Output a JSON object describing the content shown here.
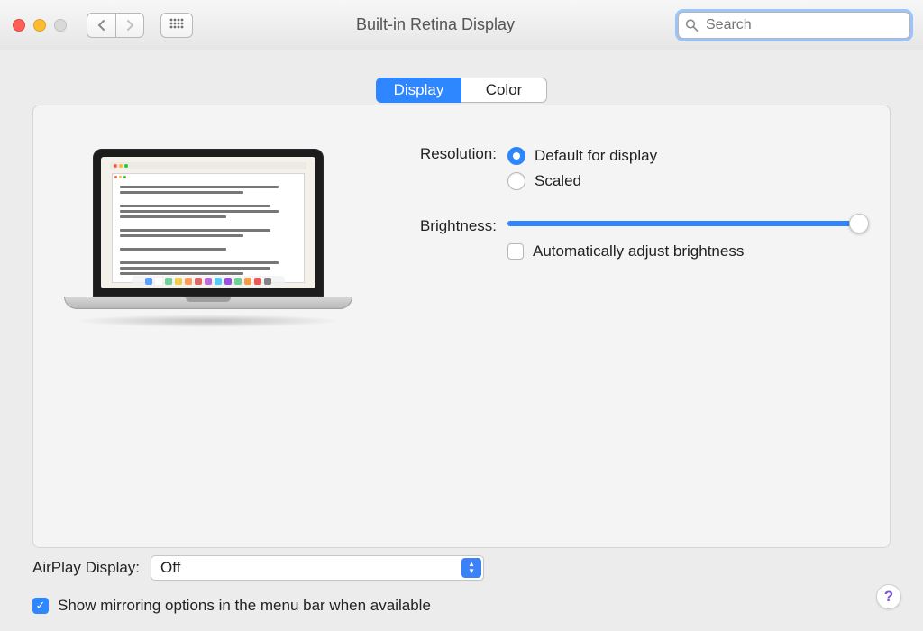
{
  "window": {
    "title": "Built-in Retina Display",
    "search_placeholder": "Search"
  },
  "tabs": {
    "display": "Display",
    "color": "Color",
    "active": "display"
  },
  "resolution": {
    "label": "Resolution:",
    "options": {
      "default": "Default for display",
      "scaled": "Scaled"
    },
    "selected": "default"
  },
  "brightness": {
    "label": "Brightness:",
    "value_pct": 100,
    "auto_label": "Automatically adjust brightness",
    "auto_checked": false
  },
  "airplay": {
    "label": "AirPlay Display:",
    "selected": "Off"
  },
  "mirroring": {
    "label": "Show mirroring options in the menu bar when available",
    "checked": true
  },
  "help_glyph": "?"
}
